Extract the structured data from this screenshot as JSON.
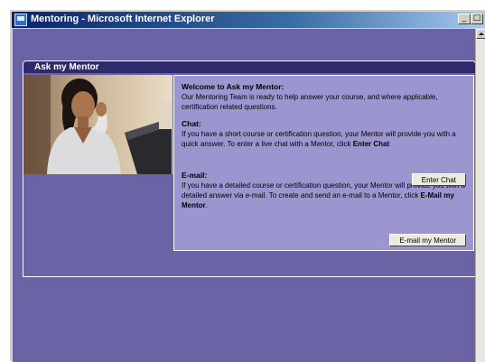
{
  "window": {
    "title": "Mentoring - Microsoft Internet Explorer",
    "min_label": "_",
    "max_label": "□"
  },
  "panel": {
    "header": "Ask my Mentor"
  },
  "welcome": {
    "heading": "Welcome to Ask my Mentor:",
    "text": "Our Mentoring Team is ready to help answer your course, and where applicable, certification related questions."
  },
  "chat": {
    "heading": "Chat:",
    "text": "If you have a short course or certification question, your Mentor will provide you with a quick answer. To enter a live chat with a Mentor, click ",
    "action_text": "Enter Chat",
    "button_label": "Enter Chat"
  },
  "email": {
    "heading": "E-mail:",
    "text": "If you have a detailed course or certification question, your Mentor will provide you with a detailed answer via e-mail. To create and send an e-mail to a Mentor, click ",
    "action_text": "E-Mail my Mentor",
    "trailing": ".",
    "button_label": "E-mail my Mentor"
  },
  "colors": {
    "page_bg": "#6a63a6",
    "panel_header": "#2e2a6c",
    "info_box": "#9c96d0",
    "title_bar": "#0a246a"
  }
}
